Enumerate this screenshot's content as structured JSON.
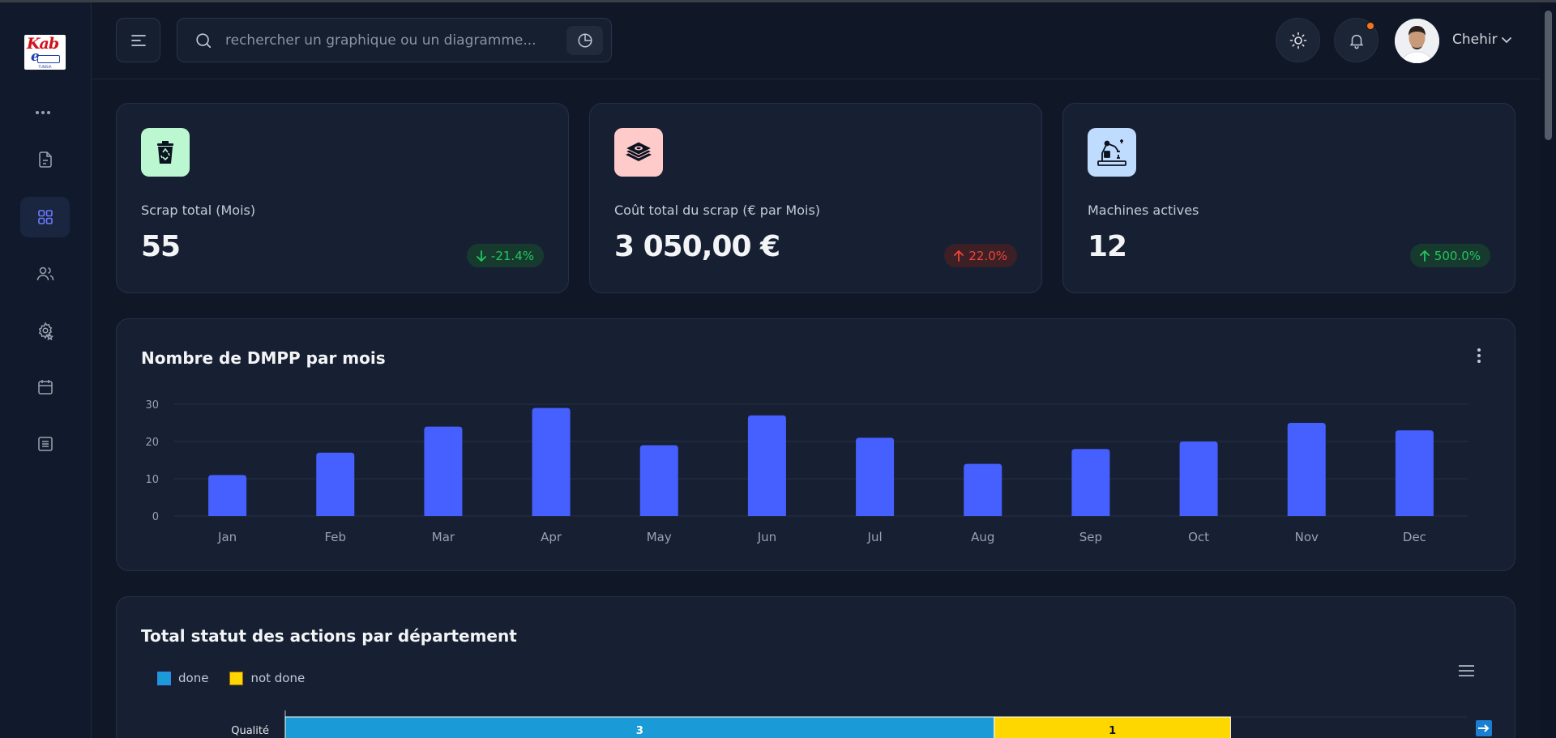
{
  "search": {
    "placeholder": "rechercher un graphique ou un diagramme..."
  },
  "user": {
    "name": "Chehir"
  },
  "logo": {
    "line1": "Kab",
    "line2": "e",
    "tagline": "TUNISIA"
  },
  "stats": [
    {
      "label": "Scrap total (Mois)",
      "value": "55",
      "change": "-21.4%",
      "trend": "down",
      "icon": "recycle-bin-icon",
      "icon_bg": "#bbf7d0"
    },
    {
      "label": "Coût total du scrap (€ par Mois)",
      "value": "3 050,00 €",
      "change": "22.0%",
      "trend": "up",
      "icon": "money-stack-icon",
      "icon_bg": "#fecaca"
    },
    {
      "label": "Machines actives",
      "value": "12",
      "change": "500.0%",
      "trend": "up",
      "icon": "robot-arm-icon",
      "icon_bg": "#bfdbfe"
    }
  ],
  "dmpp_chart": {
    "title": "Nombre de DMPP par mois"
  },
  "actions_chart": {
    "title": "Total statut des actions par département",
    "legend": [
      "done",
      "not done"
    ]
  },
  "chart_data": [
    {
      "type": "bar",
      "title": "Nombre de DMPP par mois",
      "categories": [
        "Jan",
        "Feb",
        "Mar",
        "Apr",
        "May",
        "Jun",
        "Jul",
        "Aug",
        "Sep",
        "Oct",
        "Nov",
        "Dec"
      ],
      "values": [
        11,
        17,
        24,
        29,
        19,
        27,
        21,
        14,
        18,
        20,
        25,
        23
      ],
      "yticks": [
        "0",
        "10",
        "20",
        "30"
      ],
      "ylim": [
        0,
        30
      ],
      "color": "#465fff",
      "grid": true
    },
    {
      "type": "bar",
      "orientation": "horizontal-stacked",
      "title": "Total statut des actions par département",
      "categories": [
        "Qualité"
      ],
      "series": [
        {
          "name": "done",
          "values": [
            3
          ],
          "color": "#1a9bd7"
        },
        {
          "name": "not done",
          "values": [
            1
          ],
          "color": "#ffd700"
        }
      ]
    }
  ],
  "colors": {
    "accent": "#465fff",
    "positive": "#22c55e",
    "negative": "#f04438"
  }
}
